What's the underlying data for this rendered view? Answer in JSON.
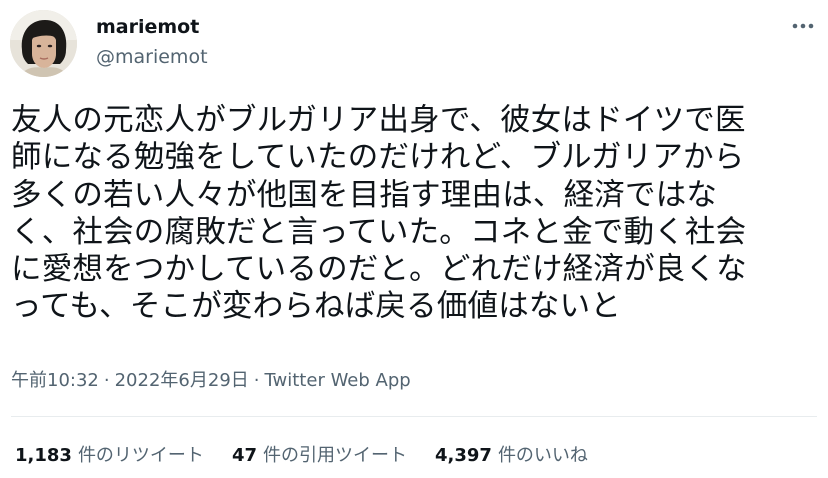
{
  "author": {
    "display_name": "mariemot",
    "handle": "@mariemot",
    "avatar_icon": "profile-photo"
  },
  "more_icon": "more-horizontal-icon",
  "tweet": {
    "lines": [
      "友人の元恋人がブルガリア出身で、彼女はドイツで医",
      "師になる勉強をしていたのだけれど、ブルガリアから",
      "多くの若い人々が他国を目指す理由は、経済ではな",
      "く、社会の腐敗だと言っていた。コネと金で動く社会",
      "に愛想をつかしているのだと。どれだけ経済が良くな",
      "っても、そこが変わらねば戻る価値はないと"
    ]
  },
  "meta": {
    "time": "午前10:32",
    "separator": "·",
    "date": "2022年6月29日",
    "source": "Twitter Web App"
  },
  "stats": {
    "retweets": {
      "count": "1,183",
      "label": "件のリツイート"
    },
    "quotes": {
      "count": "47",
      "label": "件の引用ツイート"
    },
    "likes": {
      "count": "4,397",
      "label": "件のいいね"
    }
  },
  "colors": {
    "text_primary": "#0f1419",
    "text_secondary": "#536471",
    "divider": "#e8ecee"
  }
}
